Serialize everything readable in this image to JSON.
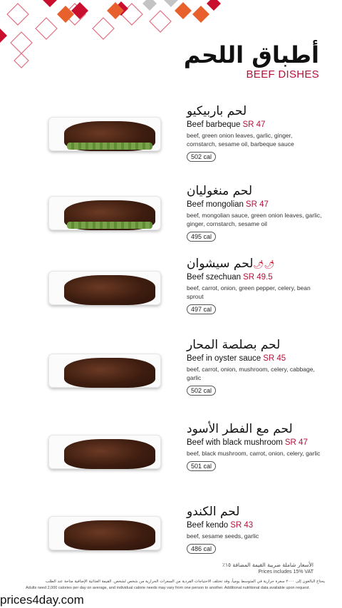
{
  "header": {
    "title_ar": "أطباق اللحم",
    "title_en": "BEEF DISHES"
  },
  "items": [
    {
      "name_ar": "لحم باربيكيو",
      "name_en": "Beef barbeque",
      "price": "SR 47",
      "desc": "beef, green onion leaves, garlic, ginger, cornstarch, sesame oil, barbeque sauce",
      "cal": "502 cal",
      "spicy": ""
    },
    {
      "name_ar": "لحم منغوليان",
      "name_en": "Beef mongolian",
      "price": "SR 47",
      "desc": "beef, mongolian sauce, green onion leaves, garlic, ginger, cornstarch, sesame oil",
      "cal": "495 cal",
      "spicy": ""
    },
    {
      "name_ar": "لحم سيشوان",
      "name_en": "Beef szechuan",
      "price": "SR 49.5",
      "desc": "beef, carrot, onion, green pepper, celery, bean sprout",
      "cal": "497 cal",
      "spicy": "🌶🌶"
    },
    {
      "name_ar": "لحم بصلصة المحار",
      "name_en": "Beef in oyster sauce",
      "price": "SR 45",
      "desc": "beef, carrot, onion, mushroom, celery, cabbage, garlic",
      "cal": "502 cal",
      "spicy": ""
    },
    {
      "name_ar": "لحم مع الفطر الأسود",
      "name_en": "Beef with black mushroom",
      "price": "SR 47",
      "desc": "beef, black mushroom, carrot, onion, celery, garlic",
      "cal": "501 cal",
      "spicy": ""
    },
    {
      "name_ar": "لحم الكندو",
      "name_en": "Beef kendo",
      "price": "SR 43",
      "desc": "beef, sesame seeds, garlic",
      "cal": "486 cal",
      "spicy": ""
    }
  ],
  "footer": {
    "vat_ar": "الأسعار شاملة ضريبة القيمة المضافة ١٥٪",
    "vat_en": "Prices includes 15% VAT",
    "note_ar": "يحتاج البالغون إلى ٢٠٠٠ سعرة حرارية في المتوسط يومياً، وقد تختلف الاحتياجات الفردية من السعرات الحرارية من شخص لشخص. القيمة الغذائية الإضافية متاحة عند الطلب",
    "note_en": "Adults need 2,000 calories per day on average, and individual calorie needs may vary from one person to another. Additional nutritional data available upon request.",
    "watermark": "prices4day.com"
  },
  "colors": {
    "accent": "#b5123b",
    "pattern_orange": "#e8612c"
  }
}
